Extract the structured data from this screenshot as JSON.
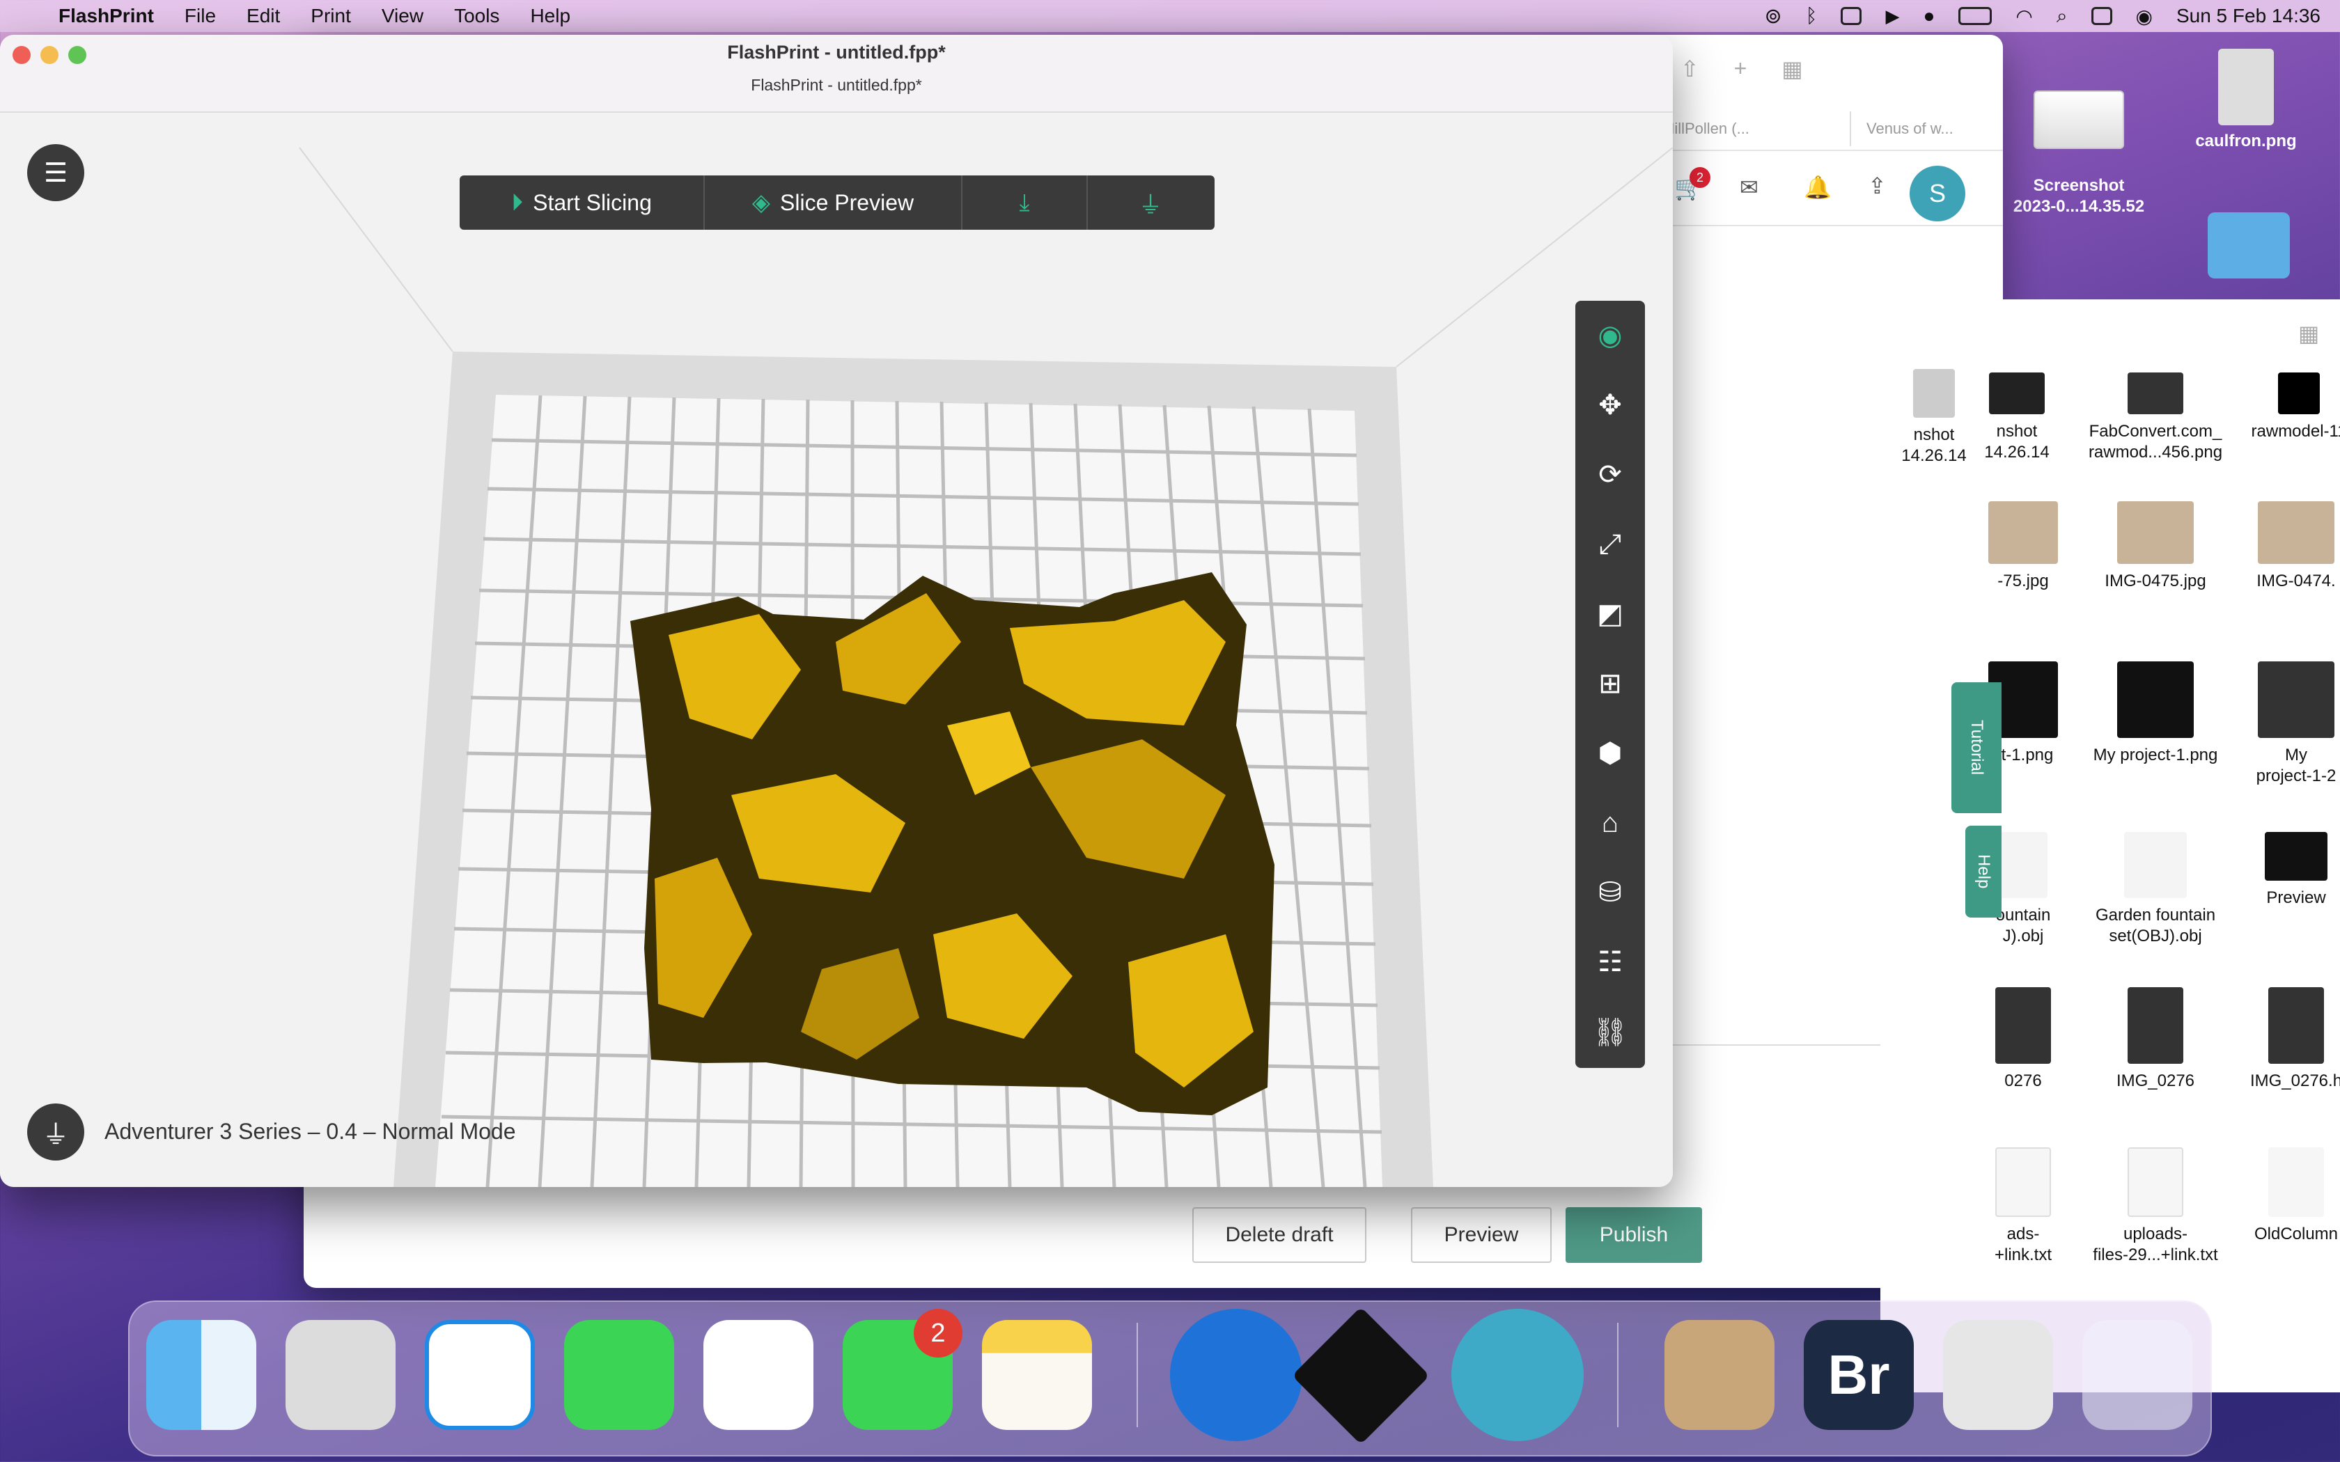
{
  "menubar": {
    "app": "FlashPrint",
    "menus": [
      "File",
      "Edit",
      "Print",
      "View",
      "Tools",
      "Help"
    ],
    "clock": "Sun 5 Feb  14:36"
  },
  "desktop": {
    "icons": [
      {
        "label": "Screenshot\n2023-0...14.35.52"
      },
      {
        "label": "caulfron.png"
      }
    ]
  },
  "browser": {
    "tabs": [
      "MillPollen (...",
      "Venus of w..."
    ],
    "cart_badge": "2",
    "avatar": "S",
    "buttons": {
      "delete": "Delete draft",
      "preview": "Preview",
      "publish": "Publish"
    }
  },
  "finder": {
    "items": [
      "nshot\n14.26.14",
      "FabConvert.com_\nrawmod...456.png",
      "rawmodel-11",
      "-75.jpg",
      "IMG-0475.jpg",
      "IMG-0474.",
      "ct-1.png",
      "My project-1.png",
      "My\nproject-1-2",
      "ountain\nJ).obj",
      "Garden fountain\nset(OBJ).obj",
      "Preview",
      "0276",
      "IMG_0276",
      "IMG_0276.h",
      "ads-\n+link.txt",
      "uploads-\nfiles-29...+link.txt",
      "OldColumn"
    ]
  },
  "flashprint": {
    "title": "FlashPrint - untitled.fpp*",
    "subtitle": "FlashPrint - untitled.fpp*",
    "toolbar": {
      "start": "Start Slicing",
      "preview": "Slice Preview"
    },
    "status": "Adventurer 3 Series – 0.4 – Normal Mode",
    "tabs": {
      "tutorial": "Tutorial",
      "help": "Help"
    },
    "accent": "#2fb98c",
    "model_color": "#e5b60e"
  },
  "dock": {
    "facetime_badge": "2",
    "apps": [
      "Finder",
      "Launchpad",
      "Safari",
      "Messages",
      "Photos",
      "FaceTime",
      "Notes",
      "Creality",
      "FlashPrint",
      "Silhouette",
      "Preview",
      "Bridge",
      "Silhouette Studio",
      "Trash"
    ]
  }
}
